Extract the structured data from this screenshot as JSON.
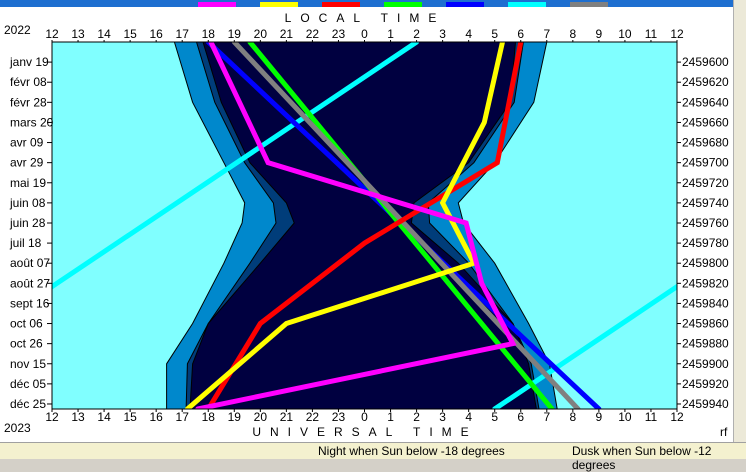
{
  "colors": {
    "day": "#80ffff",
    "twilight_light": "#0088cc",
    "twilight_dark": "#003d7a",
    "night": "#000040",
    "frame": "#000000"
  },
  "legend_colors": [
    "#ff00ff",
    "#ffff00",
    "#ff0000",
    "#00ff00",
    "#0000ff",
    "#00ffff",
    "#808080"
  ],
  "header": {
    "year_top": "2022",
    "year_bottom": "2023",
    "label_top": "LOCAL TIME",
    "label_bottom": "UNIVERSAL TIME",
    "corner_mark": "rf"
  },
  "status": {
    "night_text": "Night when Sun below -18 degrees",
    "dusk_text": "Dusk when Sun below -12 degrees"
  },
  "chart_data": {
    "type": "area",
    "title": "",
    "x_ticks_top": [
      "12",
      "13",
      "14",
      "15",
      "16",
      "17",
      "18",
      "19",
      "20",
      "21",
      "22",
      "23",
      "0",
      "1",
      "2",
      "3",
      "4",
      "5",
      "6",
      "7",
      "8",
      "9",
      "10",
      "11",
      "12"
    ],
    "x_ticks_bottom": [
      "12",
      "13",
      "14",
      "15",
      "16",
      "17",
      "18",
      "19",
      "20",
      "21",
      "22",
      "23",
      "0",
      "1",
      "2",
      "3",
      "4",
      "5",
      "6",
      "7",
      "8",
      "9",
      "10",
      "11",
      "12"
    ],
    "y_dates": [
      "janv 19",
      "févr 08",
      "févr 28",
      "mars 20",
      "avr 09",
      "avr 29",
      "mai 19",
      "juin 08",
      "juin 28",
      "juil 18",
      "août 07",
      "août 27",
      "sept 16",
      "oct 06",
      "oct 26",
      "nov 15",
      "déc 05",
      "déc 25"
    ],
    "y_jd": [
      "2459600",
      "2459620",
      "2459640",
      "2459660",
      "2459680",
      "2459700",
      "2459720",
      "2459740",
      "2459760",
      "2459780",
      "2459800",
      "2459820",
      "2459840",
      "2459860",
      "2459880",
      "2459900",
      "2459920",
      "2459940"
    ],
    "jd_range": [
      2459580,
      2459945
    ],
    "hour_range": [
      12,
      36
    ],
    "night_boundary": {
      "jd": [
        2459580,
        2459640,
        2459700,
        2459740,
        2459760,
        2459800,
        2459860,
        2459900,
        2459945
      ],
      "dusk_end_hour": [
        17.8,
        18.5,
        19.6,
        21.0,
        21.3,
        20.0,
        18.0,
        17.4,
        17.3
      ],
      "dawn_start_hour": [
        29.8,
        29.6,
        28.0,
        25.9,
        25.8,
        27.6,
        29.7,
        30.3,
        30.6
      ]
    },
    "twilight_boundary": {
      "jd": [
        2459580,
        2459640,
        2459700,
        2459740,
        2459760,
        2459800,
        2459860,
        2459900,
        2459945
      ],
      "evening_start_hour": [
        16.7,
        17.4,
        18.6,
        19.4,
        19.3,
        18.6,
        17.4,
        16.4,
        16.4
      ],
      "morning_end_hour": [
        31.0,
        30.5,
        29.0,
        27.6,
        27.8,
        29.0,
        30.3,
        31.1,
        31.4
      ]
    },
    "series": [
      {
        "color": "#00ffff",
        "points": [
          [
            2459580,
            26.0
          ],
          [
            2459945,
            5.0
          ]
        ]
      },
      {
        "color": "#0000ff",
        "points": [
          [
            2459580,
            18.0
          ],
          [
            2459945,
            33.0
          ]
        ]
      },
      {
        "color": "#00ff00",
        "points": [
          [
            2459580,
            19.6
          ],
          [
            2459945,
            31.2
          ]
        ]
      },
      {
        "color": "#808080",
        "points": [
          [
            2459580,
            19.0
          ],
          [
            2459945,
            32.2
          ]
        ]
      },
      {
        "color": "#ff0000",
        "points": [
          [
            2459580,
            30.0
          ],
          [
            2459700,
            29.1
          ],
          [
            2459780,
            24.0
          ],
          [
            2459860,
            20.0
          ],
          [
            2459945,
            18.0
          ]
        ]
      },
      {
        "color": "#ffff00",
        "points": [
          [
            2459580,
            29.3
          ],
          [
            2459660,
            28.6
          ],
          [
            2459740,
            27.0
          ],
          [
            2459800,
            28.2
          ],
          [
            2459860,
            21.0
          ],
          [
            2459945,
            17.2
          ]
        ]
      },
      {
        "color": "#ff00ff",
        "points": [
          [
            2459580,
            18.1
          ],
          [
            2459700,
            20.3
          ],
          [
            2459760,
            27.9
          ],
          [
            2459820,
            28.5
          ],
          [
            2459880,
            29.7
          ],
          [
            2459945,
            17.6
          ]
        ]
      }
    ]
  }
}
